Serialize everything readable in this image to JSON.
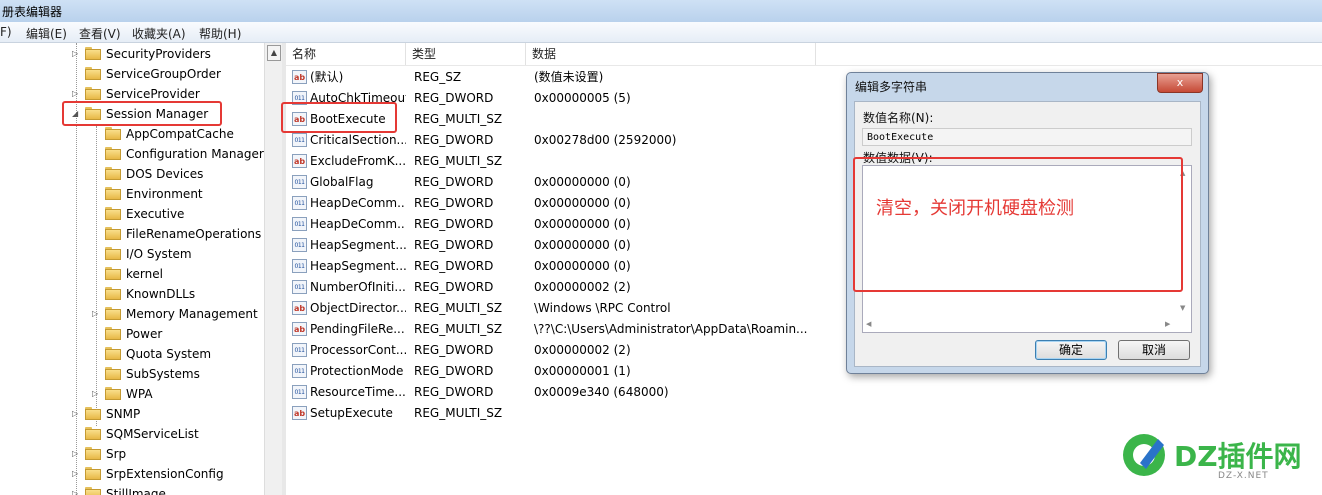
{
  "window": {
    "title": "册表编辑器"
  },
  "menu": [
    "F)",
    "编辑(E)",
    "查看(V)",
    "收藏夹(A)",
    "帮助(H)"
  ],
  "tree": {
    "items": [
      {
        "label": "SecurityProviders",
        "level": 1,
        "expander": "▷"
      },
      {
        "label": "ServiceGroupOrder",
        "level": 1,
        "expander": ""
      },
      {
        "label": "ServiceProvider",
        "level": 1,
        "expander": "▷"
      },
      {
        "label": "Session Manager",
        "level": 1,
        "expander": "◢"
      },
      {
        "label": "AppCompatCache",
        "level": 2,
        "expander": ""
      },
      {
        "label": "Configuration Manager",
        "level": 2,
        "expander": ""
      },
      {
        "label": "DOS Devices",
        "level": 2,
        "expander": ""
      },
      {
        "label": "Environment",
        "level": 2,
        "expander": ""
      },
      {
        "label": "Executive",
        "level": 2,
        "expander": ""
      },
      {
        "label": "FileRenameOperations",
        "level": 2,
        "expander": ""
      },
      {
        "label": "I/O System",
        "level": 2,
        "expander": ""
      },
      {
        "label": "kernel",
        "level": 2,
        "expander": ""
      },
      {
        "label": "KnownDLLs",
        "level": 2,
        "expander": ""
      },
      {
        "label": "Memory Management",
        "level": 2,
        "expander": "▷"
      },
      {
        "label": "Power",
        "level": 2,
        "expander": ""
      },
      {
        "label": "Quota System",
        "level": 2,
        "expander": ""
      },
      {
        "label": "SubSystems",
        "level": 2,
        "expander": ""
      },
      {
        "label": "WPA",
        "level": 2,
        "expander": "▷"
      },
      {
        "label": "SNMP",
        "level": 1,
        "expander": "▷"
      },
      {
        "label": "SQMServiceList",
        "level": 1,
        "expander": ""
      },
      {
        "label": "Srp",
        "level": 1,
        "expander": "▷"
      },
      {
        "label": "SrpExtensionConfig",
        "level": 1,
        "expander": "▷"
      },
      {
        "label": "StillImage",
        "level": 1,
        "expander": "▷"
      }
    ]
  },
  "list": {
    "columns": [
      "名称",
      "类型",
      "数据"
    ],
    "rows": [
      {
        "icon": "ab",
        "name": "(默认)",
        "type": "REG_SZ",
        "data": "(数值未设置)"
      },
      {
        "icon": "bin",
        "name": "AutoChkTimeout",
        "type": "REG_DWORD",
        "data": "0x00000005 (5)"
      },
      {
        "icon": "ab",
        "name": "BootExecute",
        "type": "REG_MULTI_SZ",
        "data": ""
      },
      {
        "icon": "bin",
        "name": "CriticalSection...",
        "type": "REG_DWORD",
        "data": "0x00278d00 (2592000)"
      },
      {
        "icon": "ab",
        "name": "ExcludeFromK...",
        "type": "REG_MULTI_SZ",
        "data": ""
      },
      {
        "icon": "bin",
        "name": "GlobalFlag",
        "type": "REG_DWORD",
        "data": "0x00000000 (0)"
      },
      {
        "icon": "bin",
        "name": "HeapDeComm...",
        "type": "REG_DWORD",
        "data": "0x00000000 (0)"
      },
      {
        "icon": "bin",
        "name": "HeapDeComm...",
        "type": "REG_DWORD",
        "data": "0x00000000 (0)"
      },
      {
        "icon": "bin",
        "name": "HeapSegment...",
        "type": "REG_DWORD",
        "data": "0x00000000 (0)"
      },
      {
        "icon": "bin",
        "name": "HeapSegment...",
        "type": "REG_DWORD",
        "data": "0x00000000 (0)"
      },
      {
        "icon": "bin",
        "name": "NumberOfIniti...",
        "type": "REG_DWORD",
        "data": "0x00000002 (2)"
      },
      {
        "icon": "ab",
        "name": "ObjectDirector...",
        "type": "REG_MULTI_SZ",
        "data": "\\Windows \\RPC Control"
      },
      {
        "icon": "ab",
        "name": "PendingFileRe...",
        "type": "REG_MULTI_SZ",
        "data": "\\??\\C:\\Users\\Administrator\\AppData\\Roamin..."
      },
      {
        "icon": "bin",
        "name": "ProcessorCont...",
        "type": "REG_DWORD",
        "data": "0x00000002 (2)"
      },
      {
        "icon": "bin",
        "name": "ProtectionMode",
        "type": "REG_DWORD",
        "data": "0x00000001 (1)"
      },
      {
        "icon": "bin",
        "name": "ResourceTime...",
        "type": "REG_DWORD",
        "data": "0x0009e340 (648000)"
      },
      {
        "icon": "ab",
        "name": "SetupExecute",
        "type": "REG_MULTI_SZ",
        "data": ""
      }
    ]
  },
  "dialog": {
    "title": "编辑多字符串",
    "close": "x",
    "name_label": "数值名称(N):",
    "name_value": "BootExecute",
    "data_label": "数值数据(V):",
    "note": "清空，关闭开机硬盘检测",
    "ok": "确定",
    "cancel": "取消"
  },
  "watermark": {
    "brand": "DZ插件网",
    "url": "DZ-X.NET"
  },
  "colors": {
    "highlight": "#e53935",
    "brand_green": "#3bb54a",
    "brand_blue": "#2a73c9"
  }
}
